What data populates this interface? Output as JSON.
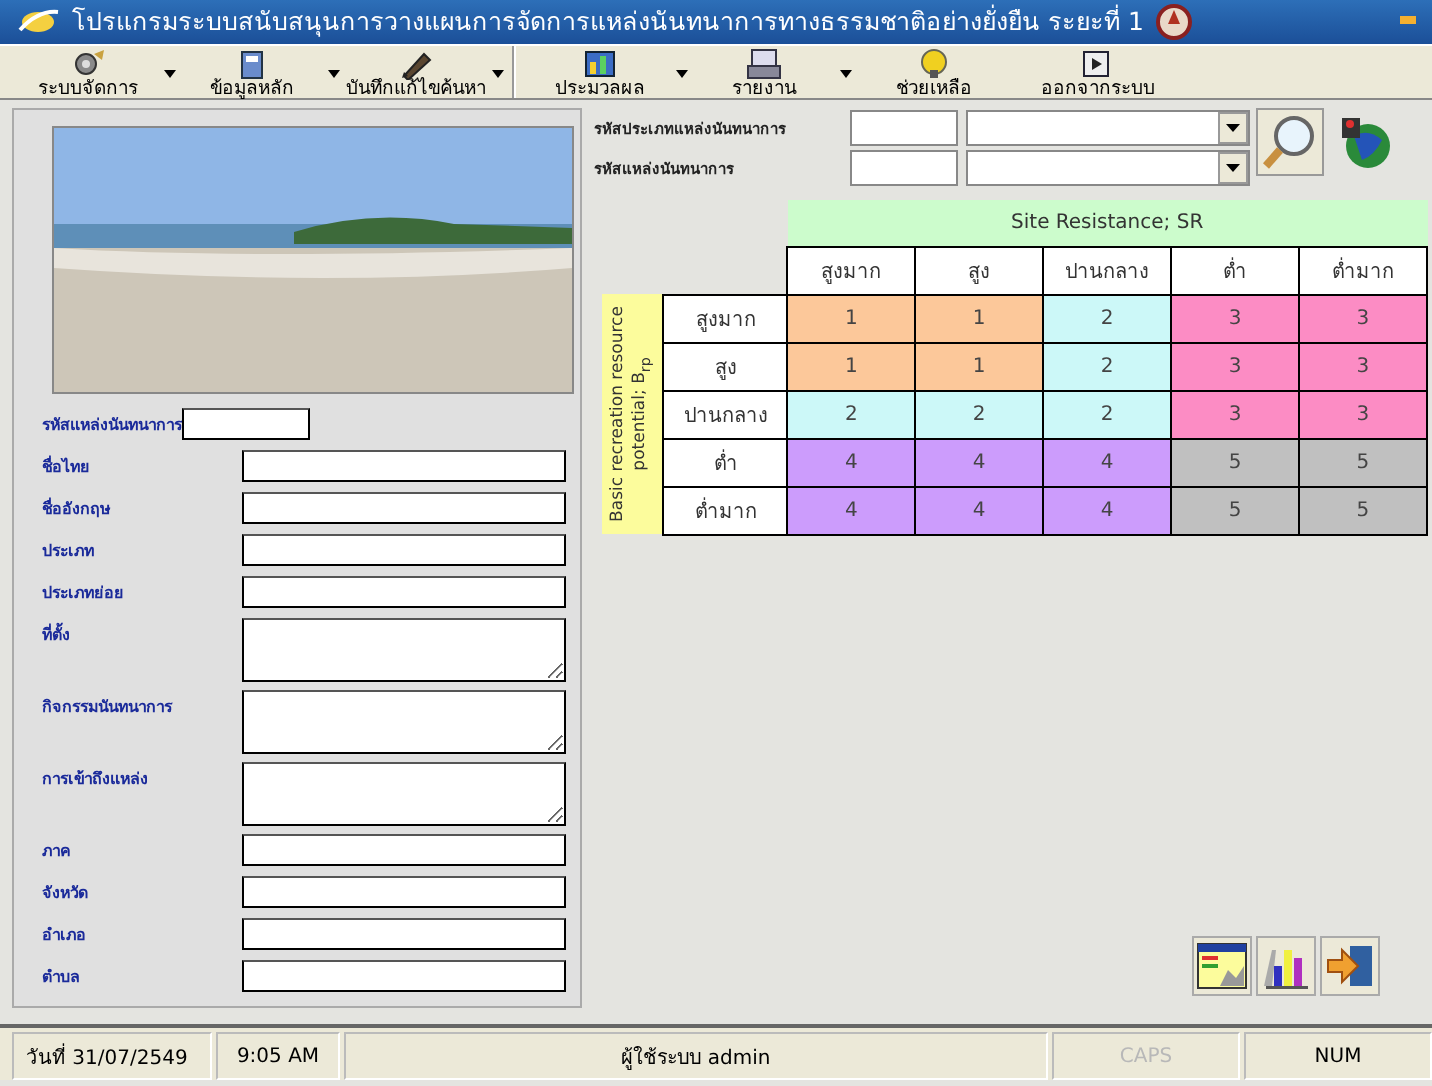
{
  "window": {
    "title": "โปรแกรมระบบสนับสนุนการวางแผนการจัดการแหล่งนันทนาการทางธรรมชาติอย่างยั่งยืน ระยะที่ 1"
  },
  "toolbar": [
    {
      "label": "ระบบจัดการ",
      "has_menu": true
    },
    {
      "label": "ข้อมูลหลัก",
      "has_menu": true
    },
    {
      "label": "บันทึกแก้ไขค้นหา",
      "has_menu": true
    },
    {
      "label": "ประมวลผล",
      "has_menu": true
    },
    {
      "label": "รายงาน",
      "has_menu": true
    },
    {
      "label": "ช่วยเหลือ",
      "has_menu": false
    },
    {
      "label": "ออกจากระบบ",
      "has_menu": false
    }
  ],
  "form": {
    "fields": [
      {
        "label": "รหัสแหล่งนันทนาการ",
        "kind": "short"
      },
      {
        "label": "ชื่อไทย",
        "kind": "line"
      },
      {
        "label": "ชื่ออังกฤษ",
        "kind": "line"
      },
      {
        "label": "ประเภท",
        "kind": "line"
      },
      {
        "label": "ประเภทย่อย",
        "kind": "line"
      },
      {
        "label": "ที่ตั้ง",
        "kind": "area"
      },
      {
        "label": "กิจกรรมนันทนาการ",
        "kind": "area"
      },
      {
        "label": "การเข้าถึงแหล่ง",
        "kind": "area"
      },
      {
        "label": "ภาค",
        "kind": "line"
      },
      {
        "label": "จังหวัด",
        "kind": "line"
      },
      {
        "label": "อำเภอ",
        "kind": "line"
      },
      {
        "label": "ตำบล",
        "kind": "line"
      }
    ]
  },
  "search": {
    "fields": [
      {
        "label": "รหัสประเภทแหล่งนันทนาการ"
      },
      {
        "label": "รหัสแหล่งนันทนาการ"
      }
    ]
  },
  "matrix": {
    "title": "Site Resistance; SR",
    "row_axis": "Basic recreation resource potential; B$_{rp}$",
    "columns": [
      "สูงมาก",
      "สูง",
      "ปานกลาง",
      "ต่ำ",
      "ต่ำมาก"
    ],
    "rows": [
      {
        "label": "สูงมาก",
        "cells": [
          {
            "value": "1",
            "color": "#fcc89a"
          },
          {
            "value": "1",
            "color": "#fcc89a"
          },
          {
            "value": "2",
            "color": "#ccf8f8"
          },
          {
            "value": "3",
            "color": "#fc8cc4"
          },
          {
            "value": "3",
            "color": "#fc8cc4"
          }
        ]
      },
      {
        "label": "สูง",
        "cells": [
          {
            "value": "1",
            "color": "#fcc89a"
          },
          {
            "value": "1",
            "color": "#fcc89a"
          },
          {
            "value": "2",
            "color": "#ccf8f8"
          },
          {
            "value": "3",
            "color": "#fc8cc4"
          },
          {
            "value": "3",
            "color": "#fc8cc4"
          }
        ]
      },
      {
        "label": "ปานกลาง",
        "cells": [
          {
            "value": "2",
            "color": "#ccf8f8"
          },
          {
            "value": "2",
            "color": "#ccf8f8"
          },
          {
            "value": "2",
            "color": "#ccf8f8"
          },
          {
            "value": "3",
            "color": "#fc8cc4"
          },
          {
            "value": "3",
            "color": "#fc8cc4"
          }
        ]
      },
      {
        "label": "ต่ำ",
        "cells": [
          {
            "value": "4",
            "color": "#cc9cfc"
          },
          {
            "value": "4",
            "color": "#cc9cfc"
          },
          {
            "value": "4",
            "color": "#cc9cfc"
          },
          {
            "value": "5",
            "color": "#c0c0c0"
          },
          {
            "value": "5",
            "color": "#c0c0c0"
          }
        ]
      },
      {
        "label": "ต่ำมาก",
        "cells": [
          {
            "value": "4",
            "color": "#cc9cfc"
          },
          {
            "value": "4",
            "color": "#cc9cfc"
          },
          {
            "value": "4",
            "color": "#cc9cfc"
          },
          {
            "value": "5",
            "color": "#c0c0c0"
          },
          {
            "value": "5",
            "color": "#c0c0c0"
          }
        ]
      }
    ]
  },
  "status_bar": {
    "date": "วันที่ 31/07/2549",
    "time": "9:05 AM",
    "user": "ผู้ใช้ระบบ admin",
    "keys": [
      {
        "label": "CAPS",
        "on": false
      },
      {
        "label": "NUM",
        "on": true
      }
    ]
  }
}
